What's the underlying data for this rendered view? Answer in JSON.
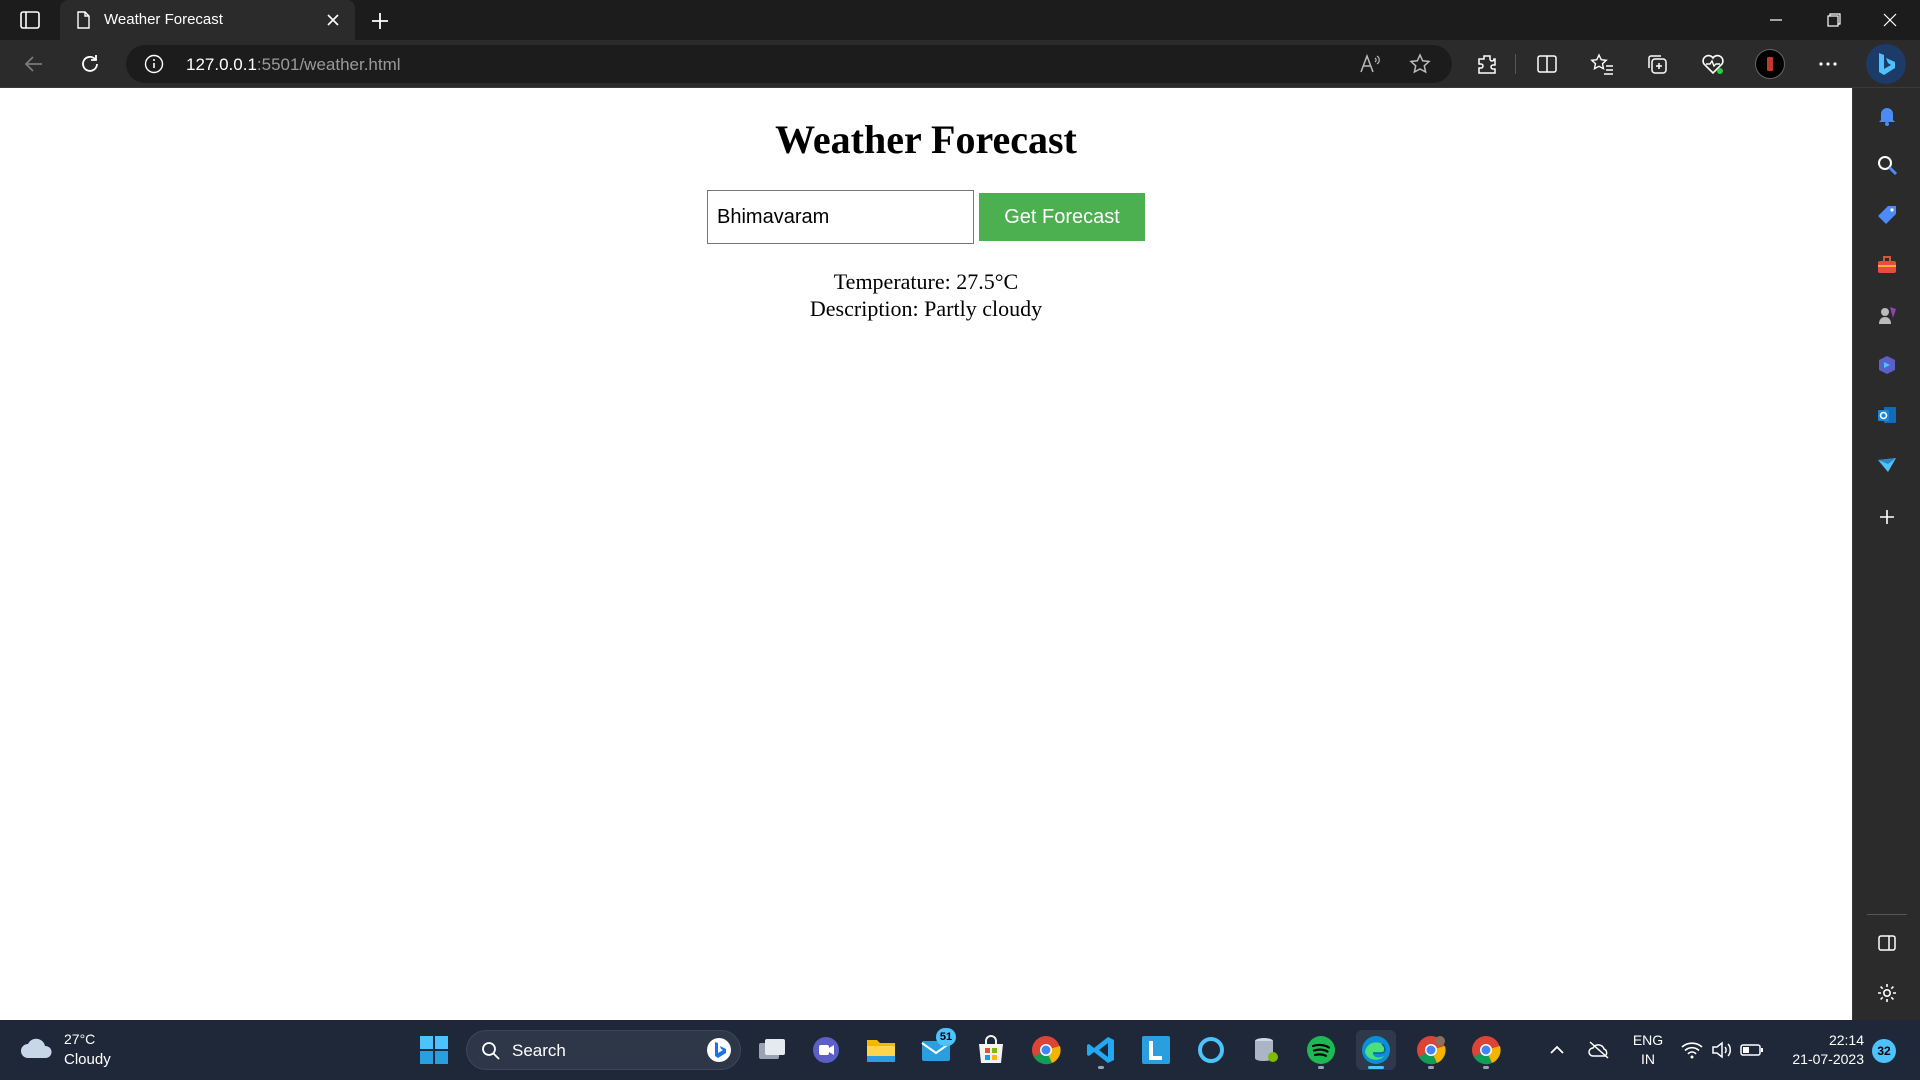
{
  "browser": {
    "tab_title": "Weather Forecast",
    "url_host": "127.0.0.1",
    "url_rest": ":5501/weather.html"
  },
  "page": {
    "heading": "Weather Forecast",
    "city_input_value": "Bhimavaram",
    "button_label": "Get Forecast",
    "temperature_line": "Temperature: 27.5°C",
    "description_line": "Description: Partly cloudy"
  },
  "taskbar": {
    "weather_temp": "27°C",
    "weather_desc": "Cloudy",
    "search_label": "Search",
    "mail_badge": "51",
    "lang_line1": "ENG",
    "lang_line2": "IN",
    "time": "22:14",
    "date": "21-07-2023",
    "notification_count": "32"
  },
  "colors": {
    "button_green": "#4caf50",
    "taskbar_bg": "#1f2838",
    "browser_dark": "#2b2b2b"
  }
}
